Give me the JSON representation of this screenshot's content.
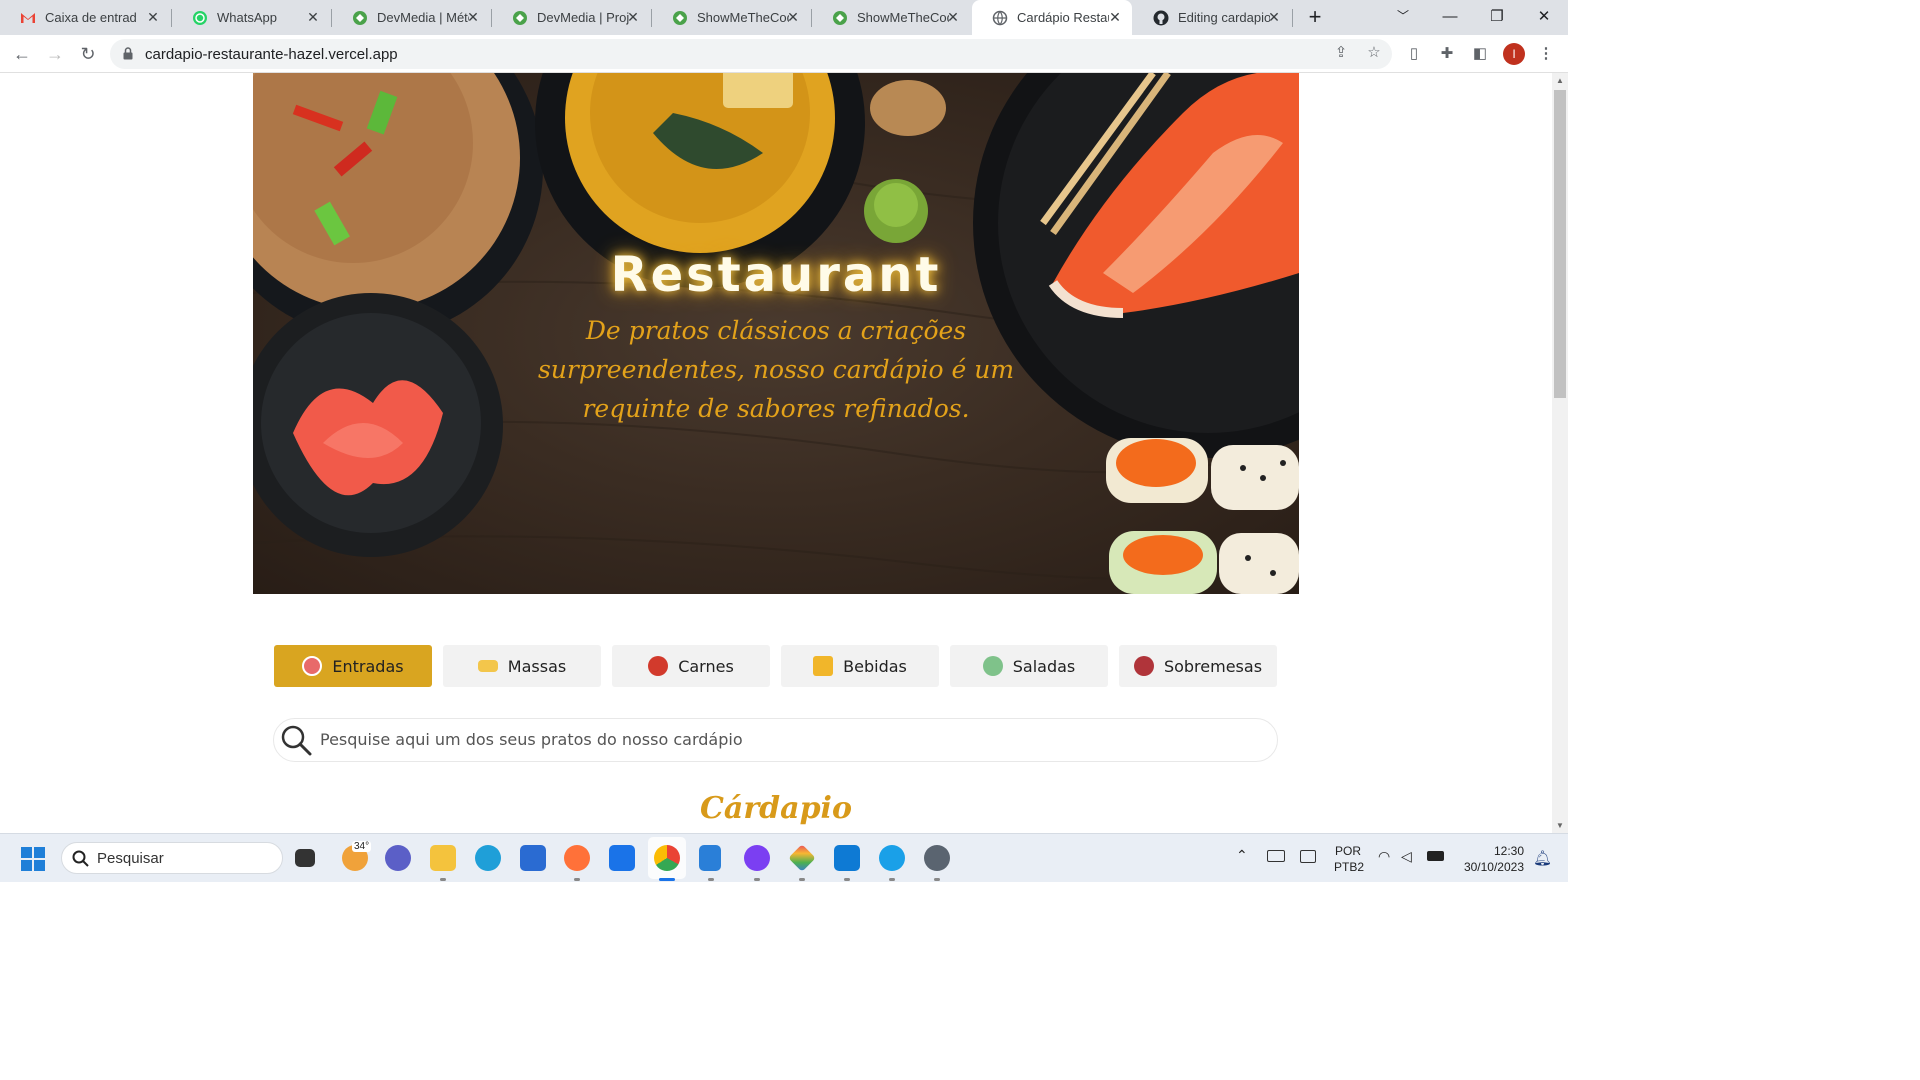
{
  "browser": {
    "tabs": [
      {
        "title": "Caixa de entrada",
        "icon": "gmail-icon",
        "active": false
      },
      {
        "title": "WhatsApp",
        "icon": "whatsapp-icon",
        "active": false
      },
      {
        "title": "DevMedia | Métodos",
        "icon": "devmedia-icon",
        "active": false
      },
      {
        "title": "DevMedia | Projetos",
        "icon": "devmedia-icon",
        "active": false
      },
      {
        "title": "ShowMeTheCode",
        "icon": "devmedia-icon",
        "active": false
      },
      {
        "title": "ShowMeTheCode",
        "icon": "devmedia-icon",
        "active": false
      },
      {
        "title": "Cardápio Restaurante",
        "icon": "globe-icon",
        "active": true
      },
      {
        "title": "Editing cardapio",
        "icon": "github-icon",
        "active": false
      }
    ],
    "url": "cardapio-restaurante-hazel.vercel.app",
    "profile_initial": "I"
  },
  "hero": {
    "title": "Restaurant",
    "subtitle": "De pratos clássicos a criações surpreendentes, nosso cardápio é um requinte de sabores refinados."
  },
  "categories": [
    {
      "label": "Entradas",
      "icon": "appetizer-icon",
      "active": true,
      "color": "#e86a6a"
    },
    {
      "label": "Massas",
      "icon": "pasta-icon",
      "active": false,
      "color": "#f3c64b"
    },
    {
      "label": "Carnes",
      "icon": "meat-icon",
      "active": false,
      "color": "#d23a2c"
    },
    {
      "label": "Bebidas",
      "icon": "drinks-icon",
      "active": false,
      "color": "#f1b62a"
    },
    {
      "label": "Saladas",
      "icon": "salad-icon",
      "active": false,
      "color": "#7fc28a"
    },
    {
      "label": "Sobremesas",
      "icon": "dessert-icon",
      "active": false,
      "color": "#b0343a"
    }
  ],
  "search": {
    "placeholder": "Pesquise aqui um dos seus pratos do nosso cardápio"
  },
  "section_title": "Cárdapio",
  "taskbar": {
    "search_placeholder": "Pesquisar",
    "weather": "34°",
    "language": "POR",
    "keyboard": "PTB2",
    "time": "12:30",
    "date": "30/10/2023"
  },
  "colors": {
    "accent": "#d9a520",
    "hero_text": "#e3a21a",
    "section_title": "#d89a1a"
  }
}
